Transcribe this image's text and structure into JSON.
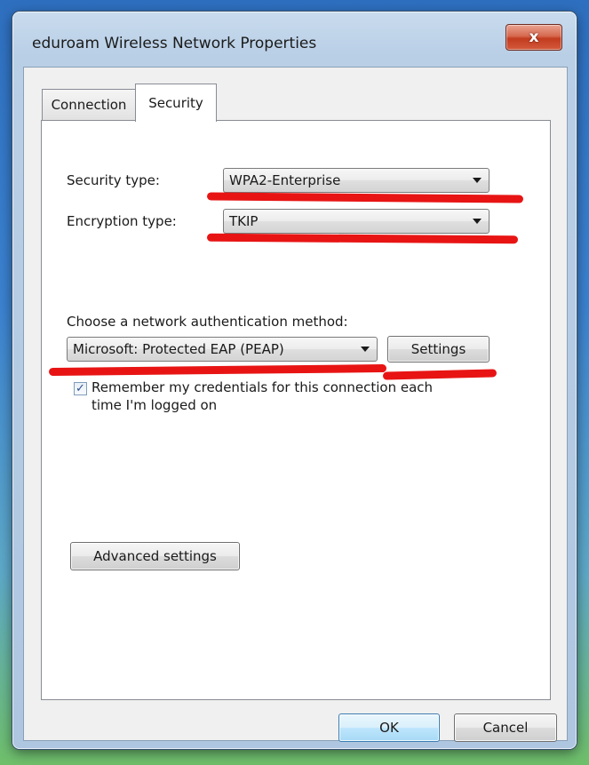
{
  "window": {
    "title": "eduroam Wireless Network Properties",
    "close_glyph": "x"
  },
  "tabs": [
    {
      "label": "Connection",
      "selected": false
    },
    {
      "label": "Security",
      "selected": true
    }
  ],
  "security": {
    "security_type_label": "Security type:",
    "security_type_value": "WPA2-Enterprise",
    "encryption_type_label": "Encryption type:",
    "encryption_type_value": "TKIP",
    "auth_method_label": "Choose a network authentication method:",
    "auth_method_value": "Microsoft: Protected EAP (PEAP)",
    "settings_button": "Settings",
    "remember_checkbox_checked": true,
    "remember_line1": "Remember my credentials for this connection each",
    "remember_line2": "time I'm logged on",
    "advanced_button": "Advanced settings"
  },
  "footer": {
    "ok_button": "OK",
    "cancel_button": "Cancel"
  },
  "colors": {
    "highlight_marks": "#e60000",
    "titlebar": "#b9cfe6",
    "close_button": "#c23b1f"
  },
  "icons": [
    "close-icon",
    "dropdown-arrow-icon",
    "checkmark-icon"
  ]
}
